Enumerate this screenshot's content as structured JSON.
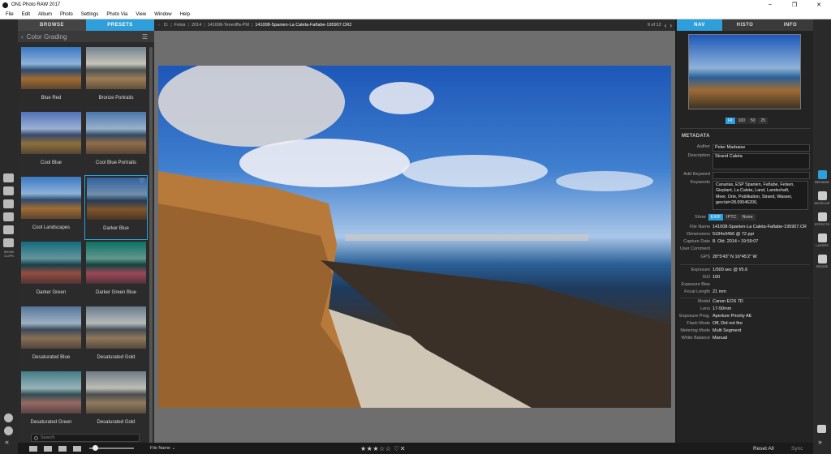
{
  "window": {
    "title": "ON1 Photo RAW 2017",
    "controls": [
      "–",
      "❐",
      "✕"
    ]
  },
  "menu": [
    "File",
    "Edit",
    "Album",
    "Photo",
    "Settings",
    "Photo Via",
    "View",
    "Window",
    "Help"
  ],
  "left_panel": {
    "tabs": [
      "BROWSE",
      "PRESETS"
    ],
    "active_tab": "PRESETS",
    "category": "Color Grading",
    "presets": [
      "Blue Red",
      "Bronze Portraits",
      "Cool Blue",
      "Cool Blue Portraits",
      "Cool Landscapes",
      "Darker Blue",
      "Darker Green",
      "Darker Green Blue",
      "Desaturated Blue",
      "Desaturated Gold",
      "Desaturated Green",
      "Desaturated Gold"
    ],
    "selected_preset": "Darker Blue",
    "search_placeholder": "Search"
  },
  "left_rail": {
    "label": "SHOW CLIPS"
  },
  "path": {
    "crumbs": [
      "D:",
      "Fotos",
      "2014",
      "141008-Teneriffa-PM",
      "141008-Spanien-La Caleta-Fañabe-195907.CR2"
    ],
    "counter": "9 of 12"
  },
  "right_panel": {
    "tabs": [
      "NAV",
      "HISTO",
      "INFO"
    ],
    "active_tab": "NAV",
    "zoom": [
      "Fit",
      "100",
      "50",
      "25"
    ],
    "active_zoom": "Fit",
    "metadata_title": "METADATA",
    "author_label": "Author",
    "author": "Peter Marbaise",
    "description_label": "Description",
    "description": "Strand Caleta",
    "add_keyword_label": "Add Keyword",
    "keywords_label": "Keywords",
    "keywords": "Canarias, ESP Spanien, Fañabe, Felsen, Gieplant, La Caleta, Land, Landschaft, Meer, Orte, Publikation, Strand, Wasser, geo:lat=28.09546200,",
    "show_label": "Show",
    "show_options": [
      "EXIF",
      "IPTC",
      "None"
    ],
    "active_show": "EXIF",
    "exif": [
      {
        "k": "File Name",
        "v": "141008-Spanien-La Caleta-Fañabe-195907.CR"
      },
      {
        "k": "Dimensions",
        "v": "5184x3456 @ 72 ppi"
      },
      {
        "k": "Capture Date",
        "v": "8. Okt. 2014 • 19:59:07"
      },
      {
        "k": "User Comment",
        "v": ""
      },
      {
        "k": "GPS",
        "v": "28°5'43\" N 16°45'2\" W"
      }
    ],
    "exif2": [
      {
        "k": "Exposure",
        "v": "1/500 sec @ f/5.6"
      },
      {
        "k": "ISO",
        "v": "100"
      },
      {
        "k": "Exposure Bias",
        "v": ""
      },
      {
        "k": "Focal Length",
        "v": "21 mm"
      }
    ],
    "exif3": [
      {
        "k": "Model",
        "v": "Canon EOS 7D"
      },
      {
        "k": "Lens",
        "v": "17-50mm"
      },
      {
        "k": "Exposure Prog.",
        "v": "Aperture Priority AE"
      },
      {
        "k": "Flash Mode",
        "v": "Off, Did not fire"
      },
      {
        "k": "Metering Mode",
        "v": "Multi Segment"
      },
      {
        "k": "White Balance",
        "v": "Manual"
      }
    ]
  },
  "right_rail": [
    "BROWSE",
    "DEVELOP",
    "EFFECTS",
    "LAYERS",
    "RESIZE"
  ],
  "bottom": {
    "sort": "File Name",
    "rating": "★★★☆☆",
    "flags": "♡✕",
    "reset_all": "Reset All",
    "sync": "Sync"
  },
  "colors": {
    "accent": "#2e9fdb"
  }
}
